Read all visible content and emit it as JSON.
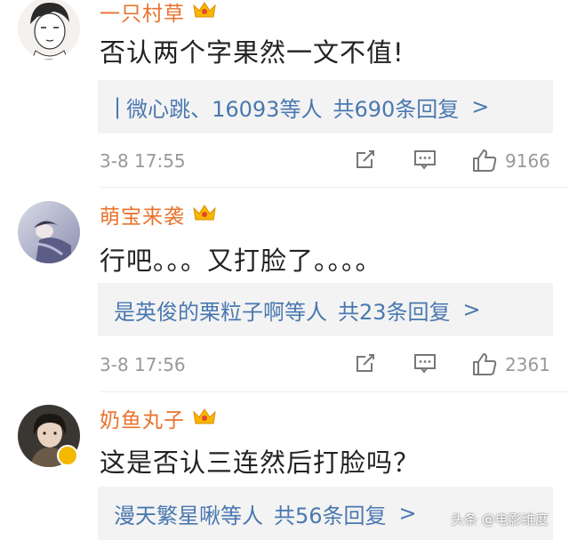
{
  "comments": [
    {
      "username": "一只村草",
      "text": "否认两个字果然一文不值!",
      "reply_prefix": "|",
      "reply_users": "微心跳、16093等人",
      "reply_total": "共690条回复",
      "reply_chevron": ">",
      "time": "3-8 17:55",
      "likes": "9166"
    },
    {
      "username": "萌宝来袭",
      "text": "行吧。。。又打脸了。。。。",
      "reply_users": "是英俊的栗粒子啊等人",
      "reply_total": "共23条回复",
      "reply_chevron": ">",
      "time": "3-8 17:56",
      "likes": "2361"
    },
    {
      "username": "奶鱼丸子",
      "text": "这是否认三连然后打脸吗？",
      "reply_users": "漫天繁星啾等人",
      "reply_total": "共56条回复",
      "reply_chevron": ">"
    }
  ],
  "watermark": "头条 @电影维度",
  "colors": {
    "username": "#e8732c",
    "link": "#4a78b0",
    "meta": "#999999",
    "reply_bg": "#f3f3f3"
  }
}
